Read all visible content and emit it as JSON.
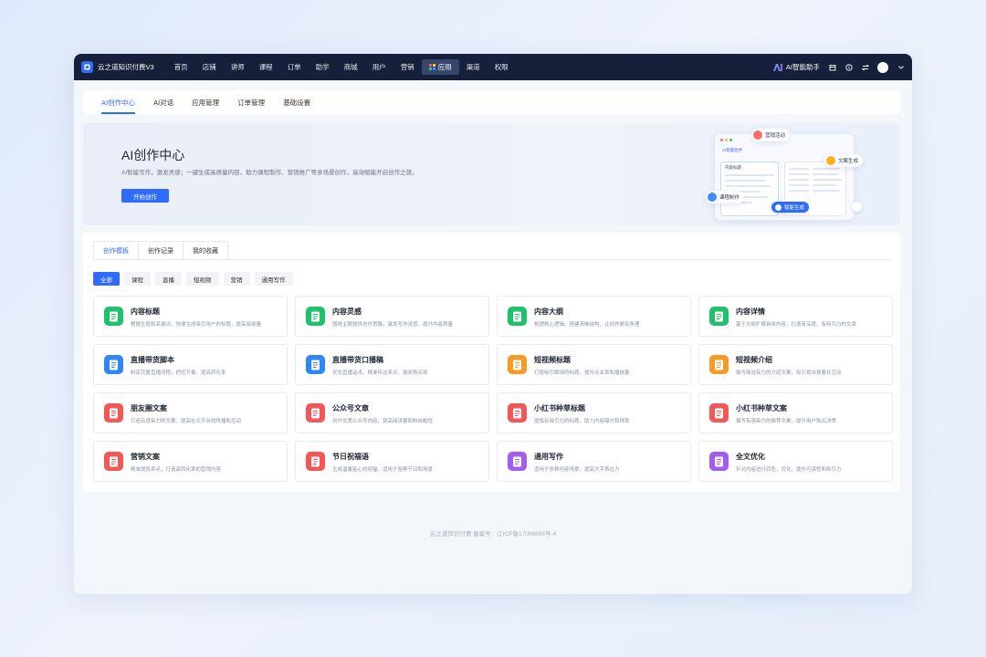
{
  "topbar": {
    "brand": "云之道知识付费V3",
    "nav": [
      {
        "label": "首页",
        "active": false
      },
      {
        "label": "店铺",
        "active": false
      },
      {
        "label": "讲师",
        "active": false
      },
      {
        "label": "课程",
        "active": false
      },
      {
        "label": "订单",
        "active": false
      },
      {
        "label": "助学",
        "active": false
      },
      {
        "label": "商城",
        "active": false
      },
      {
        "label": "用户",
        "active": false
      },
      {
        "label": "营销",
        "active": false
      },
      {
        "label": "应用",
        "active": true
      },
      {
        "label": "渠道",
        "active": false
      },
      {
        "label": "权限",
        "active": false
      }
    ],
    "ai_helper": "AI智能助手"
  },
  "subtabs": [
    {
      "label": "AI创作中心",
      "active": true
    },
    {
      "label": "AI对话",
      "active": false
    },
    {
      "label": "应用管理",
      "active": false
    },
    {
      "label": "订单管理",
      "active": false
    },
    {
      "label": "基础设置",
      "active": false
    }
  ],
  "hero": {
    "title": "AI创作中心",
    "description": "AI智能写作，激发灵感；一键生成高质量内容，助力课程制作、营销推广等多场景创作，高效赋能开启创作之旅。",
    "button": "开始创作",
    "illustration": {
      "chip_marketing": "营销活动",
      "chip_copy": "文案生成",
      "chip_course": "课程制作",
      "chip_generate": "智能生成",
      "panel_title": "AI智能助手",
      "panel_heading": "内容标题"
    }
  },
  "content_tabs": [
    {
      "label": "创作模板",
      "active": true
    },
    {
      "label": "创作记录",
      "active": false
    },
    {
      "label": "我的收藏",
      "active": false
    }
  ],
  "filters": [
    {
      "label": "全部",
      "active": true
    },
    {
      "label": "课程",
      "active": false
    },
    {
      "label": "直播",
      "active": false
    },
    {
      "label": "短视频",
      "active": false
    },
    {
      "label": "营销",
      "active": false
    },
    {
      "label": "通用写作",
      "active": false
    }
  ],
  "cards": [
    {
      "title": "内容标题",
      "desc": "根据主题和关键词，快速生成吸引用户的标题，提高阅读量",
      "icon": "document-icon",
      "color": "#1fc16b"
    },
    {
      "title": "内容灵感",
      "desc": "围绕主题提供创作思路，激发写作灵感，提升内容质量",
      "icon": "copy-icon",
      "color": "#1fc16b"
    },
    {
      "title": "内容大纲",
      "desc": "梳理核心逻辑，搭建清晰结构，让创作更有条理",
      "icon": "outline-icon",
      "color": "#1fc16b"
    },
    {
      "title": "内容详情",
      "desc": "基于大纲扩展具体内容，打造有深度、有吸引力的文章",
      "icon": "detail-icon",
      "color": "#1fc16b"
    },
    {
      "title": "直播带货脚本",
      "desc": "制定完整直播流程，把控节奏，提高转化率",
      "icon": "bag-icon",
      "color": "#2f86f6"
    },
    {
      "title": "直播带货口播稿",
      "desc": "优化直播话术，精准传达卖点，激发购买欲",
      "icon": "script-icon",
      "color": "#2f86f6"
    },
    {
      "title": "短视频标题",
      "desc": "打造吸引眼球的标题，提升点击率和播放量",
      "icon": "video-title-icon",
      "color": "#f59a23"
    },
    {
      "title": "短视频介绍",
      "desc": "撰写简洁有力的介绍文案，吸引观众观看并互动",
      "icon": "video-intro-icon",
      "color": "#f59a23"
    },
    {
      "title": "朋友圈文案",
      "desc": "打造有感染力的文案，提高社交平台的传播和互动",
      "icon": "moments-icon",
      "color": "#f25656"
    },
    {
      "title": "公众号文章",
      "desc": "创作优质公众号内容，提高阅读量和粉丝黏性",
      "icon": "article-icon",
      "color": "#f25656"
    },
    {
      "title": "小红书种草标题",
      "desc": "提炼有吸引力的标题，助力内容曝光和种草",
      "icon": "rednote-title-icon",
      "color": "#f25656"
    },
    {
      "title": "小红书种草文案",
      "desc": "撰写有感染力的推荐文案，提升用户购买决策",
      "icon": "rednote-copy-icon",
      "color": "#f25656"
    },
    {
      "title": "营销文案",
      "desc": "精准提炼卖点，打造高转化率的营销内容",
      "icon": "marketing-icon",
      "color": "#f25656"
    },
    {
      "title": "节日祝福语",
      "desc": "生成温馨贴心的祝福，适用于各种节日和场景",
      "icon": "blessing-icon",
      "color": "#f25656"
    },
    {
      "title": "通用写作",
      "desc": "适用于多种内容场景，提高文字表达力",
      "icon": "write-icon",
      "color": "#a45cf0"
    },
    {
      "title": "全文优化",
      "desc": "针对内容进行润色、优化，提升可读性和吸引力",
      "icon": "optimize-icon",
      "color": "#a45cf0"
    }
  ],
  "footer": "云之道知识付费  备案号：辽ICP备17006698号-4"
}
